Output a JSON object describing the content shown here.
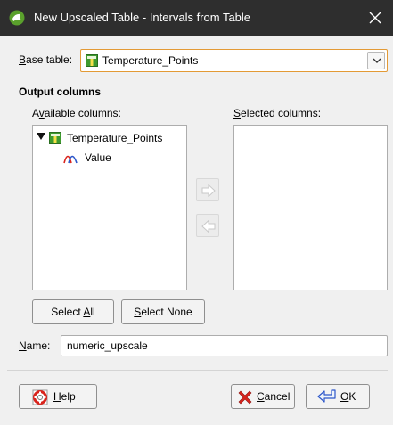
{
  "window": {
    "title": "New Upscaled Table - Intervals from Table",
    "icons": {
      "app": "leapfrog-app-icon",
      "close": "close-icon"
    }
  },
  "base_table": {
    "label_key": "B",
    "label_rest": "ase table:",
    "selected_value": "Temperature_Points",
    "icon": "table-icon"
  },
  "output_columns": {
    "heading": "Output columns",
    "available": {
      "label_pre": "A",
      "label_key": "v",
      "label_post": "ailable columns:",
      "tree": [
        {
          "label": "Temperature_Points",
          "icon": "table-icon",
          "expanded": true,
          "children": [
            {
              "label": "Value",
              "icon": "numeric-column-icon"
            }
          ]
        }
      ]
    },
    "selected": {
      "label_key": "S",
      "label_rest": "elected columns:",
      "items": []
    },
    "move_buttons": {
      "add_icon": "arrow-right-icon",
      "remove_icon": "arrow-left-icon"
    },
    "select_all": {
      "label_pre": "Select ",
      "label_key": "A",
      "label_post": "ll"
    },
    "select_none": {
      "label_key": "S",
      "label_rest": "elect None"
    }
  },
  "name_field": {
    "label_key": "N",
    "label_rest": "ame:",
    "value": "numeric_upscale"
  },
  "footer": {
    "help": {
      "label_key": "H",
      "label_rest": "elp",
      "icon": "lifebuoy-icon"
    },
    "cancel": {
      "label_key": "C",
      "label_rest": "ancel",
      "icon": "red-x-icon"
    },
    "ok": {
      "label_key": "O",
      "label_rest": "K",
      "icon": "return-arrow-icon"
    }
  },
  "colors": {
    "titlebar": "#2e2e2e",
    "focus_border": "#e39a35",
    "table_icon_green": "#3e9a2f",
    "cancel_red": "#d9231c"
  }
}
